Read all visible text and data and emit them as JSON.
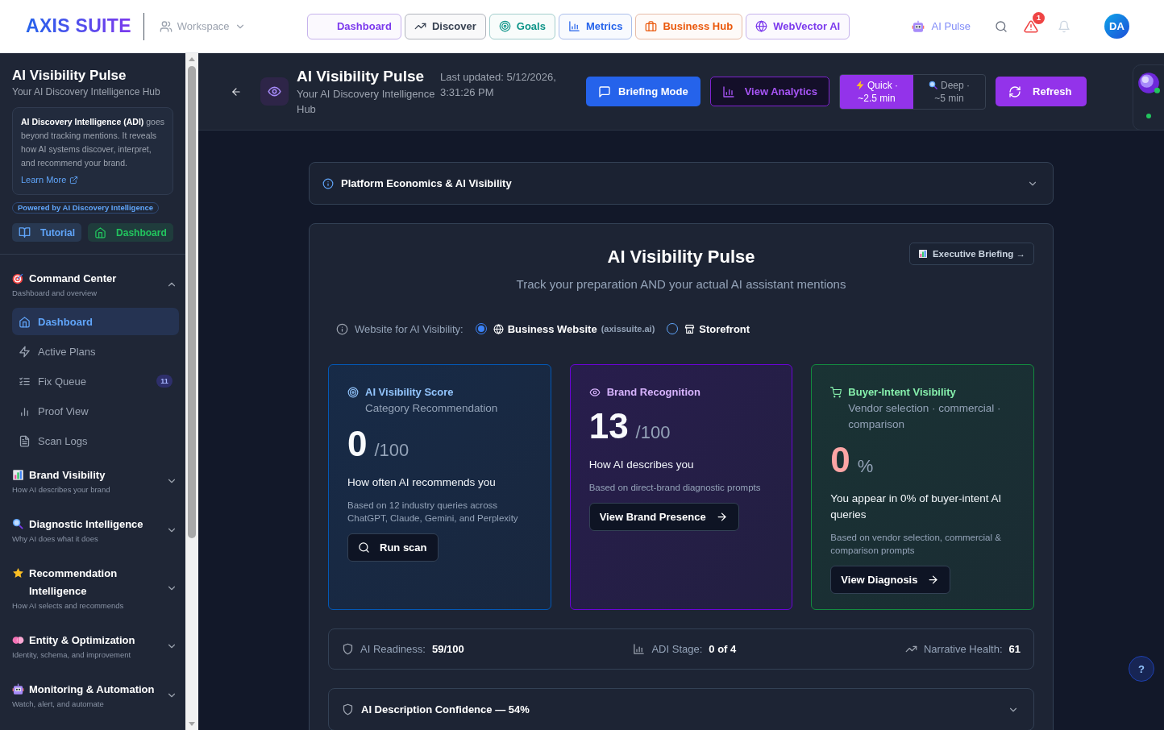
{
  "topbar": {
    "logo": "AXIS SUITE",
    "workspace": "Workspace",
    "nav": [
      {
        "label": "Dashboard",
        "color": "#7c3aed"
      },
      {
        "label": "Discover",
        "color": "#374151"
      },
      {
        "label": "Goals",
        "color": "#0d9488"
      },
      {
        "label": "Metrics",
        "color": "#2563eb"
      },
      {
        "label": "Business Hub",
        "color": "#ea580c"
      },
      {
        "label": "WebVector AI",
        "color": "#7c3aed"
      }
    ],
    "pulse_link": "AI Pulse",
    "alert_count": "1",
    "avatar": "DA"
  },
  "sidebar": {
    "title": "AI Visibility Pulse",
    "subtitle": "Your AI Discovery Intelligence Hub",
    "intro": {
      "text": "**AI Discovery Intelligence (ADI)** goes beyond tracking mentions. It reveals how AI systems discover, interpret, and recommend your brand.",
      "link": "Learn More"
    },
    "badge": "Powered by AI Discovery Intelligence",
    "quick_buttons": [
      {
        "label": "Tutorial",
        "color": "#60a5fa"
      },
      {
        "label": "Dashboard",
        "color": "#22c55e"
      }
    ],
    "sections": [
      {
        "title": "Command Center",
        "subtitle": "Dashboard and overview",
        "expanded": true,
        "items": [
          {
            "label": "Dashboard",
            "selected": true
          },
          {
            "label": "Active Plans",
            "selected": false
          },
          {
            "label": "Fix Queue",
            "selected": false,
            "count": "11"
          },
          {
            "label": "Proof View",
            "selected": false
          },
          {
            "label": "Scan Logs",
            "selected": false
          }
        ]
      },
      {
        "title": "Brand Visibility",
        "subtitle": "How AI describes your brand",
        "expanded": false
      },
      {
        "title": "Diagnostic Intelligence",
        "subtitle": "Why AI does what it does",
        "expanded": false
      },
      {
        "title": "Recommendation Intelligence",
        "subtitle": "How AI selects and recommends",
        "expanded": false
      },
      {
        "title": "Entity & Optimization",
        "subtitle": "Identity, schema, and improvement",
        "expanded": false
      },
      {
        "title": "Monitoring & Automation",
        "subtitle": "Watch, alert, and automate",
        "expanded": false
      }
    ]
  },
  "header": {
    "title": "AI Visibility Pulse",
    "subtitle": "Your AI Discovery Intelligence Hub",
    "updated": "Last updated: 5/12/2026, 3:31:26 PM",
    "briefing_button": "Briefing Mode",
    "analytics_button": "View Analytics",
    "scan_modes": [
      {
        "label": "Quick ·",
        "time": "~2.5 min",
        "selected": true
      },
      {
        "label": "Deep ·",
        "time": "~5 min",
        "selected": false
      }
    ],
    "refresh_button": "Refresh"
  },
  "main": {
    "economics_panel": {
      "title": "Platform Economics & AI Visibility",
      "expanded": false
    },
    "pulse": {
      "title": "AI Visibility Pulse",
      "subtitle": "Track your preparation AND your actual AI assistant mentions",
      "briefing_link": "Executive Briefing →",
      "website_choice": {
        "label": "Website for AI Visibility:",
        "options": [
          {
            "label": "Business Website",
            "detail": "(axissuite.ai)",
            "selected": true
          },
          {
            "label": "Storefront",
            "selected": false
          }
        ]
      },
      "cards": [
        {
          "title": "AI Visibility Score",
          "subtitle": "Category Recommendation",
          "color": "#93c5fd",
          "score": "0",
          "unit": "/100",
          "alert": false,
          "caption": "How often AI recommends you",
          "note": "Based on 12 industry queries across ChatGPT, Claude, Gemini, and Perplexity",
          "action": {
            "label": "Run scan",
            "kind": "scan"
          }
        },
        {
          "title": "Brand Recognition",
          "color": "#d8b4fe",
          "score": "13",
          "unit": "/100",
          "alert": false,
          "caption": "How AI describes you",
          "note": "Based on direct-brand diagnostic prompts",
          "action": {
            "label": "View Brand Presence",
            "kind": "link"
          }
        },
        {
          "title": "Buyer-Intent Visibility",
          "subtitle": "Vendor selection · commercial · comparison",
          "color": "#86efac",
          "score": "0",
          "unit": "%",
          "alert": true,
          "caption": "You appear in 0% of buyer-intent AI queries",
          "note": "Based on vendor selection, commercial & comparison prompts",
          "action": {
            "label": "View Diagnosis",
            "kind": "link"
          }
        }
      ],
      "stats": [
        {
          "label": "AI Readiness:",
          "value": "59/100"
        },
        {
          "label": "ADI Stage:",
          "value": "0 of 4"
        },
        {
          "label": "Narrative Health:",
          "value": "61"
        }
      ],
      "confidence_panel": {
        "title": "AI Description Confidence — 54%",
        "expanded": false
      }
    },
    "help_button": "?"
  }
}
